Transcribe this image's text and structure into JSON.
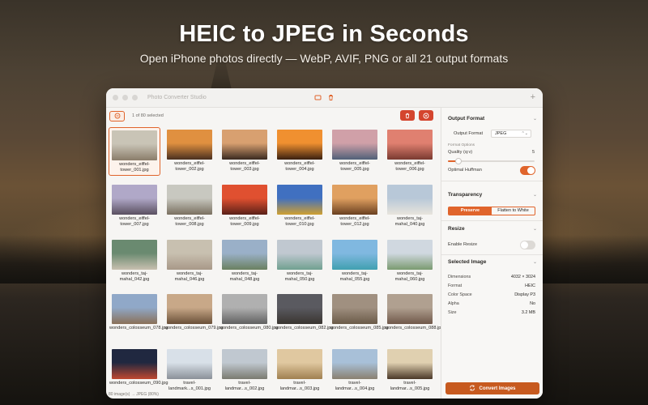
{
  "hero": {
    "title": "HEIC to JPEG in Seconds",
    "subtitle": "Open iPhone photos directly — WebP, AVIF, PNG or all 21 output formats"
  },
  "window": {
    "title": "Photo Converter Studio",
    "titlebar_icons": [
      "window-icon",
      "trash-icon"
    ],
    "add_icon": "plus-icon"
  },
  "toolbar": {
    "select_icon": "select-circle-icon",
    "selection_text": "1 of 80 selected",
    "delete_icon": "trash-icon",
    "remove_icon": "remove-circle-icon"
  },
  "images": [
    {
      "name": "wonders_eiffel-tower_001.jpg",
      "selected": true,
      "colors": [
        "#c9c4b6",
        "#8a7d6a"
      ]
    },
    {
      "name": "wonders_eiffel-tower_002.jpg",
      "colors": [
        "#e09040",
        "#4a3020"
      ]
    },
    {
      "name": "wonders_eiffel-tower_003.jpg",
      "colors": [
        "#d8a070",
        "#3a2a20"
      ]
    },
    {
      "name": "wonders_eiffel-tower_004.jpg",
      "colors": [
        "#f09030",
        "#3a2010"
      ]
    },
    {
      "name": "wonders_eiffel-tower_005.jpg",
      "colors": [
        "#d0a0a8",
        "#506078"
      ]
    },
    {
      "name": "wonders_eiffel-tower_006.jpg",
      "colors": [
        "#e08070",
        "#7a3a30"
      ]
    },
    {
      "name": "wonders_eiffel-tower_007.jpg",
      "colors": [
        "#b0a8c8",
        "#5a5060"
      ]
    },
    {
      "name": "wonders_eiffel-tower_008.jpg",
      "colors": [
        "#c8c8c0",
        "#7a7060"
      ]
    },
    {
      "name": "wonders_eiffel-tower_009.jpg",
      "colors": [
        "#e05030",
        "#5a2018"
      ]
    },
    {
      "name": "wonders_eiffel-tower_010.jpg",
      "colors": [
        "#4070c0",
        "#d0a030"
      ]
    },
    {
      "name": "wonders_eiffel-tower_012.jpg",
      "colors": [
        "#e0a060",
        "#6a4020"
      ]
    },
    {
      "name": "wonders_taj-mahal_040.jpg",
      "colors": [
        "#b8c8d8",
        "#e8e4dc"
      ]
    },
    {
      "name": "wonders_taj-mahal_042.jpg",
      "colors": [
        "#6a8a70",
        "#c8c0b0"
      ]
    },
    {
      "name": "wonders_taj-mahal_046.jpg",
      "colors": [
        "#c8c0b0",
        "#a89888"
      ]
    },
    {
      "name": "wonders_taj-mahal_048.jpg",
      "colors": [
        "#9ab0c8",
        "#6a8060"
      ]
    },
    {
      "name": "wonders_taj-mahal_050.jpg",
      "colors": [
        "#c0c8d0",
        "#70a090"
      ]
    },
    {
      "name": "wonders_taj-mahal_055.jpg",
      "colors": [
        "#80b8e0",
        "#40a0b0"
      ]
    },
    {
      "name": "wonders_taj-mahal_060.jpg",
      "colors": [
        "#d0d8e0",
        "#7a9a70"
      ]
    },
    {
      "name": "wonders_colosseum_078.jpg",
      "colors": [
        "#90a8c8",
        "#8a7058"
      ]
    },
    {
      "name": "wonders_colosseum_079.jpg",
      "colors": [
        "#c8a888",
        "#6a5038"
      ]
    },
    {
      "name": "wonders_colosseum_080.jpg",
      "colors": [
        "#b0b0b0",
        "#606060"
      ]
    },
    {
      "name": "wonders_colosseum_082.jpg",
      "colors": [
        "#5a5a60",
        "#3a3530"
      ]
    },
    {
      "name": "wonders_colosseum_085.jpg",
      "colors": [
        "#a09080",
        "#6a5a48"
      ]
    },
    {
      "name": "wonders_colosseum_088.jpg",
      "colors": [
        "#b0a090",
        "#70584a"
      ]
    },
    {
      "name": "wonders_colosseum_090.jpg",
      "colors": [
        "#202840",
        "#c04830"
      ]
    },
    {
      "name": "travel-landmark...s_001.jpg",
      "colors": [
        "#d8e0e8",
        "#8a9098"
      ]
    },
    {
      "name": "travel-landmar...s_002.jpg",
      "colors": [
        "#c0c8d0",
        "#7a7a70"
      ]
    },
    {
      "name": "travel-landmar...s_003.jpg",
      "colors": [
        "#e0c8a0",
        "#a08050"
      ]
    },
    {
      "name": "travel-landmar...s_004.jpg",
      "colors": [
        "#a8c0d8",
        "#8a8070"
      ]
    },
    {
      "name": "travel-landmar...s_005.jpg",
      "colors": [
        "#e0d0b0",
        "#4a3828"
      ]
    }
  ],
  "status": "80 image(s) → JPEG (80%)",
  "sidebar": {
    "output_format": {
      "title": "Output Format",
      "format_label": "Output Format",
      "format_value": "JPEG",
      "options_label": "Format Options",
      "quality_label": "Quality (q:v)",
      "quality_value": "5",
      "quality_fraction": 0.12,
      "huffman_label": "Optimal Huffman",
      "huffman_on": true
    },
    "transparency": {
      "title": "Transparency",
      "options": [
        "Preserve",
        "Flatten to White"
      ],
      "active": 0
    },
    "resize": {
      "title": "Resize",
      "enable_label": "Enable Resize",
      "enable_on": false
    },
    "selected_image": {
      "title": "Selected Image",
      "rows": [
        {
          "k": "Dimensions",
          "v": "4032 × 3024"
        },
        {
          "k": "Format",
          "v": "HEIC"
        },
        {
          "k": "Color Space",
          "v": "Display P3"
        },
        {
          "k": "Alpha",
          "v": "No"
        },
        {
          "k": "Size",
          "v": "3.2 MB"
        }
      ]
    },
    "convert_label": "Convert Images"
  },
  "colors": {
    "accent": "#e0642b",
    "danger": "#d4452e",
    "convert": "#c75a1f"
  }
}
